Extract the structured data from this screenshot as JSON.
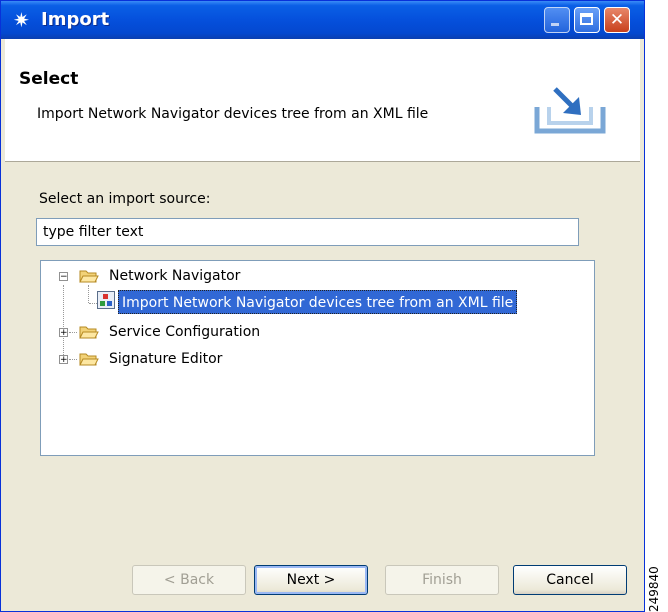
{
  "window": {
    "title": "Import",
    "title_icon": "✷",
    "controls": {
      "close_glyph": "✕"
    }
  },
  "header": {
    "title": "Select",
    "description": "Import Network Navigator devices tree from an XML file",
    "icon": "import-wizard-icon"
  },
  "source": {
    "label": "Select an import source:",
    "filter_value": "type filter text"
  },
  "tree": {
    "items": [
      {
        "label": "Network Navigator",
        "expanded": true,
        "icon": "folder-open-icon"
      },
      {
        "label": "Import Network Navigator devices tree from an XML file",
        "selected": true,
        "icon": "network-navigator-icon"
      },
      {
        "label": "Service Configuration",
        "expanded": false,
        "icon": "folder-icon"
      },
      {
        "label": "Signature Editor",
        "expanded": false,
        "icon": "folder-icon"
      }
    ]
  },
  "buttons": {
    "back": "< Back",
    "next": "Next >",
    "finish": "Finish",
    "cancel": "Cancel"
  },
  "watermark": "249840",
  "colors": {
    "titlebar": "#0550dc",
    "selection": "#3168d5",
    "dialog_bg": "#ece9d8"
  }
}
